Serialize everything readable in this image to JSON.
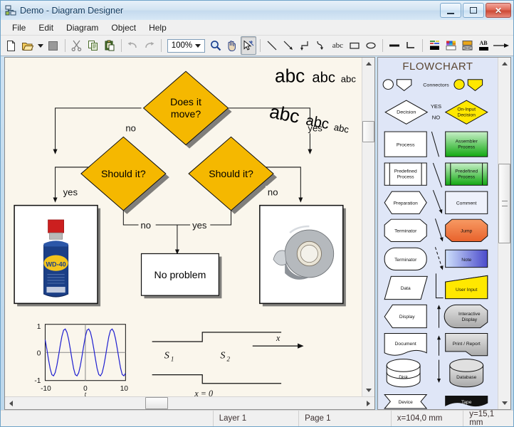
{
  "window": {
    "title": "Demo - Diagram Designer",
    "icon": "diagram-app-icon",
    "buttons": {
      "minimize": "Minimize",
      "maximize": "Maximize",
      "close": "Close"
    }
  },
  "menubar": {
    "items": [
      {
        "label": "File",
        "name": "menu-file"
      },
      {
        "label": "Edit",
        "name": "menu-edit"
      },
      {
        "label": "Diagram",
        "name": "menu-diagram"
      },
      {
        "label": "Object",
        "name": "menu-object"
      },
      {
        "label": "Help",
        "name": "menu-help"
      }
    ]
  },
  "toolbar": {
    "zoom_value": "100%",
    "buttons": [
      {
        "name": "new-document-icon",
        "tip": "New"
      },
      {
        "name": "open-folder-icon",
        "tip": "Open"
      },
      {
        "name": "open-dropdown-icon",
        "tip": "Open recent"
      },
      {
        "name": "save-icon",
        "tip": "Save"
      },
      {
        "name": "cut-scissors-icon",
        "tip": "Cut"
      },
      {
        "name": "copy-icon",
        "tip": "Copy"
      },
      {
        "name": "paste-clipboard-icon",
        "tip": "Paste"
      },
      {
        "name": "undo-icon",
        "tip": "Undo"
      },
      {
        "name": "redo-icon",
        "tip": "Redo"
      },
      {
        "name": "zoom-magnifier-icon",
        "tip": "Zoom"
      },
      {
        "name": "pan-hand-icon",
        "tip": "Pan"
      },
      {
        "name": "select-pointer-icon",
        "tip": "Select"
      },
      {
        "name": "line-tool-icon",
        "tip": "Line"
      },
      {
        "name": "arrow-tool-icon",
        "tip": "Arrow"
      },
      {
        "name": "elbow-connector-icon",
        "tip": "Elbow connector"
      },
      {
        "name": "curve-connector-icon",
        "tip": "Curved connector"
      },
      {
        "name": "text-tool-icon",
        "tip": "Text"
      },
      {
        "name": "rectangle-tool-icon",
        "tip": "Rectangle"
      },
      {
        "name": "ellipse-tool-icon",
        "tip": "Ellipse"
      },
      {
        "name": "line-style-icon",
        "tip": "Line style"
      },
      {
        "name": "corner-style-icon",
        "tip": "Corner style"
      },
      {
        "name": "line-color-icon",
        "tip": "Line color"
      },
      {
        "name": "fill-color-icon",
        "tip": "Fill color"
      },
      {
        "name": "shadow-color-icon",
        "tip": "Shadow color"
      },
      {
        "name": "font-color-icon",
        "tip": "Font color"
      },
      {
        "name": "arrow-style-icon",
        "tip": "Arrow style"
      }
    ],
    "text_tool_label": "abc",
    "font-color-label": "AB"
  },
  "canvas": {
    "background_color": "#faf6ec",
    "flowchart": {
      "nodes": [
        {
          "id": "n1",
          "type": "decision",
          "label": "Does it\nmove?",
          "line1": "Does it",
          "line2": "move?",
          "fill": "#f5b800"
        },
        {
          "id": "n2",
          "type": "decision",
          "label": "Should it?",
          "fill": "#f5b800"
        },
        {
          "id": "n3",
          "type": "decision",
          "label": "Should it?",
          "fill": "#f5b800"
        },
        {
          "id": "n4",
          "type": "image",
          "label": "WD-40 spray can"
        },
        {
          "id": "n5",
          "type": "process",
          "label": "No problem",
          "fill": "#ffffff"
        },
        {
          "id": "n6",
          "type": "image",
          "label": "duct tape roll"
        }
      ],
      "edge_labels": [
        {
          "id": "e1",
          "text": "no"
        },
        {
          "id": "e2",
          "text": "yes"
        },
        {
          "id": "e3",
          "text": "yes"
        },
        {
          "id": "e4",
          "text": "no"
        },
        {
          "id": "e5",
          "text": "no"
        },
        {
          "id": "e6",
          "text": "yes"
        }
      ]
    },
    "text_samples": [
      {
        "id": "t1",
        "parts": [
          "abc",
          "abc",
          "abc"
        ],
        "rotated": false
      },
      {
        "id": "t2",
        "parts": [
          "abc",
          "abc",
          "abc"
        ],
        "rotated": true
      }
    ],
    "wd40": {
      "brand": "WD-40",
      "cap_color": "#cc1f1f",
      "body_color": "#1b3f86",
      "oval_color": "#f3c41c"
    },
    "step_diagram": {
      "label_s1": "S",
      "label_s1_sub": "1",
      "label_s2": "S",
      "label_s2_sub": "2",
      "label_x": "x",
      "label_x0": "x = 0"
    }
  },
  "chart_data": {
    "type": "line",
    "title": "",
    "xlabel": "t",
    "ylabel": "",
    "xlim": [
      -12,
      12
    ],
    "ylim": [
      -1.2,
      1.2
    ],
    "xticks": [
      "-10",
      "0",
      "10"
    ],
    "yticks": [
      "1",
      "0",
      "-1"
    ],
    "grid": true,
    "line_color": "#2020d0",
    "series": [
      {
        "name": "sin",
        "description": "sine wave, amplitude 1, about 3 periods over x = -12..12",
        "x": [
          -12,
          -11.5,
          -11,
          -10.5,
          -10,
          -9.5,
          -9,
          -8.5,
          -8,
          -7.5,
          -7,
          -6.5,
          -6,
          -5.5,
          -5,
          -4.5,
          -4,
          -3.5,
          -3,
          -2.5,
          -2,
          -1.5,
          -1,
          -0.5,
          0,
          0.5,
          1,
          1.5,
          2,
          2.5,
          3,
          3.5,
          4,
          4.5,
          5,
          5.5,
          6,
          6.5,
          7,
          7.5,
          8,
          8.5,
          9,
          9.5,
          10,
          10.5,
          11,
          11.5,
          12
        ],
        "y": [
          0.54,
          0.14,
          -0.31,
          -0.7,
          -0.95,
          -1.0,
          -0.86,
          -0.55,
          -0.14,
          0.3,
          0.69,
          0.95,
          1.0,
          0.86,
          0.56,
          0.15,
          -0.29,
          -0.69,
          -0.95,
          -1.0,
          -0.87,
          -0.57,
          -0.16,
          0.28,
          0.68,
          0.95,
          1.0,
          0.87,
          0.57,
          0.17,
          -0.27,
          -0.68,
          -0.94,
          -1.0,
          -0.88,
          -0.58,
          -0.18,
          0.26,
          0.67,
          0.94,
          1.0,
          0.88,
          0.59,
          0.19,
          -0.25,
          -0.66,
          -0.94,
          -1.0,
          -0.89
        ]
      }
    ]
  },
  "palette": {
    "title": "FLOWCHART",
    "connectors_label": "Connectors",
    "decision_yes": "YES",
    "decision_no": "NO",
    "shapes": [
      {
        "name": "connector-circle-white",
        "label": ""
      },
      {
        "name": "connector-pentagon-white",
        "label": ""
      },
      {
        "name": "connector-circle-yellow",
        "label": ""
      },
      {
        "name": "connector-pentagon-yellow",
        "label": ""
      },
      {
        "name": "decision",
        "label": "Decision"
      },
      {
        "name": "on-input-decision",
        "label": "On-Input\nDecision",
        "l1": "On-Input",
        "l2": "Decision"
      },
      {
        "name": "process",
        "label": "Process"
      },
      {
        "name": "assembler-process",
        "label": "Assembler\nProcess",
        "l1": "Assembler",
        "l2": "Process"
      },
      {
        "name": "predefined-process",
        "label": "Predefined\nProcess",
        "l1": "Predefined",
        "l2": "Process"
      },
      {
        "name": "predefined-process-green",
        "label": "Predefined\nProcess",
        "l1": "Predefined",
        "l2": "Process"
      },
      {
        "name": "preparation",
        "label": "Preparation"
      },
      {
        "name": "comment",
        "label": "Comment"
      },
      {
        "name": "terminator",
        "label": "Terminator"
      },
      {
        "name": "jump",
        "label": "Jump"
      },
      {
        "name": "terminator-round",
        "label": "Terminator"
      },
      {
        "name": "note",
        "label": "Note"
      },
      {
        "name": "data",
        "label": "Data"
      },
      {
        "name": "user-input",
        "label": "User Input"
      },
      {
        "name": "display",
        "label": "Display"
      },
      {
        "name": "interactive-display",
        "label": "Interactive\nDisplay",
        "l1": "Interactive",
        "l2": "Display"
      },
      {
        "name": "document",
        "label": "Document"
      },
      {
        "name": "print-report",
        "label": "Print / Report"
      },
      {
        "name": "disk",
        "label": "Disk"
      },
      {
        "name": "database",
        "label": "Database"
      },
      {
        "name": "device",
        "label": "Device"
      },
      {
        "name": "tape",
        "label": "Tape"
      }
    ],
    "colors": {
      "background": "#dfe6f7",
      "green": "#22bb33",
      "yellow": "#ffe800",
      "orange": "#f2793d",
      "blue": "#5a5ad8",
      "gray": "#bfbfbf"
    }
  },
  "statusbar": {
    "layer": "Layer 1",
    "page": "Page 1",
    "x": "x=104,0 mm",
    "y": "y=15,1 mm"
  }
}
